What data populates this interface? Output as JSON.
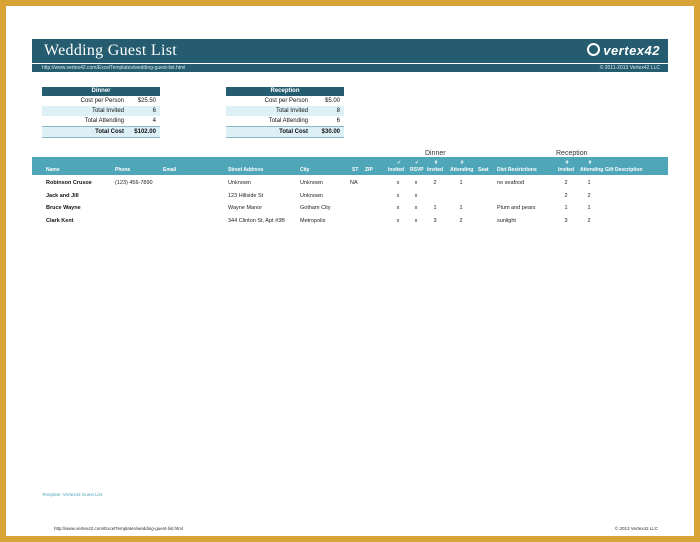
{
  "header": {
    "title": "Wedding Guest List",
    "logo": "vertex42",
    "url": "http://www.vertex42.com/ExcelTemplates/wedding-guest-list.html",
    "copyright": "© 2011-2013 Vertex42 LLC"
  },
  "dinner": {
    "title": "Dinner",
    "cost_label": "Cost per Person",
    "cost_value": "$25.50",
    "invited_label": "Total Invited",
    "invited_value": "6",
    "attending_label": "Total Attending",
    "attending_value": "4",
    "total_label": "Total Cost",
    "total_value": "$102.00"
  },
  "reception": {
    "title": "Reception",
    "cost_label": "Cost per Person",
    "cost_value": "$5.00",
    "invited_label": "Total Invited",
    "invited_value": "8",
    "attending_label": "Total Attending",
    "attending_value": "6",
    "total_label": "Total Cost",
    "total_value": "$30.00"
  },
  "table": {
    "group_dinner": "Dinner",
    "group_reception": "Reception",
    "col_name": "Name",
    "col_phone": "Phone",
    "col_email": "Email",
    "col_street": "Street Address",
    "col_city": "City",
    "col_st": "ST",
    "col_zip": "ZIP",
    "col_invited_top": "✓",
    "col_invited": "Invited",
    "col_rsvp_top": "✓",
    "col_rsvp": "RSVP",
    "col_d_invited_top": "#",
    "col_d_invited": "Invited",
    "col_d_attending_top": "#",
    "col_d_attending": "Attending",
    "col_seat": "Seat",
    "col_diet": "Diet Restrictions",
    "col_r_invited_top": "#",
    "col_r_invited": "Invited",
    "col_r_attending_top": "#",
    "col_r_attending": "Attending",
    "col_gift": "Gift Description",
    "rows": [
      {
        "name": "Robinson Crusoe",
        "phone": "(123) 456-7890",
        "street": "Unknown",
        "city": "Unknown",
        "st": "NA",
        "invited": "x",
        "rsvp": "x",
        "d_inv": "2",
        "d_att": "1",
        "diet": "no seafood",
        "r_inv": "2",
        "r_att": "1"
      },
      {
        "name": "Jack and Jill",
        "phone": "",
        "street": "123 Hillside St",
        "city": "Unknown",
        "st": "",
        "invited": "x",
        "rsvp": "x",
        "d_inv": "",
        "d_att": "",
        "diet": "",
        "r_inv": "2",
        "r_att": "2"
      },
      {
        "name": "Bruce Wayne",
        "phone": "",
        "street": "Wayne Manor",
        "city": "Gotham City",
        "st": "",
        "invited": "x",
        "rsvp": "x",
        "d_inv": "1",
        "d_att": "1",
        "diet": "Plum and pears",
        "r_inv": "1",
        "r_att": "1"
      },
      {
        "name": "Clark Kent",
        "phone": "",
        "street": "344 Clinton St, Apt #3B",
        "city": "Metropolis",
        "st": "",
        "invited": "x",
        "rsvp": "x",
        "d_inv": "3",
        "d_att": "2",
        "diet": "sunlight",
        "r_inv": "3",
        "r_att": "2"
      }
    ]
  },
  "footnote": "Template: Vertex42 Guest List",
  "footer": {
    "url": "http://www.vertex42.com/ExcelTemplates/wedding-guest-list.html",
    "copyright": "© 2013 Vertex42 LLC"
  }
}
